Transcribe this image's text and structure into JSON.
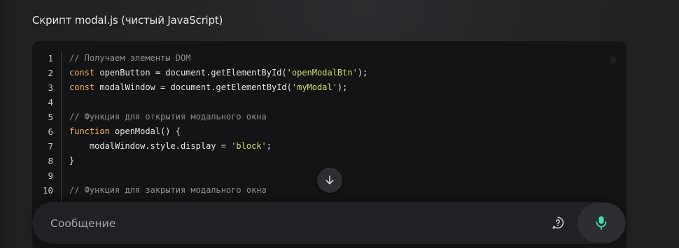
{
  "header": {
    "title": "Скрипт modal.js (чистый JavaScript)"
  },
  "code_block": {
    "line_numbers": [
      "1",
      "2",
      "3",
      "4",
      "5",
      "6",
      "7",
      "8",
      "9",
      "10"
    ],
    "lines": [
      [
        {
          "text": "// Получаем элементы DOM",
          "type": "comment"
        }
      ],
      [
        {
          "text": "const",
          "type": "keyword"
        },
        {
          "text": " openButton = document.getElementById(",
          "type": "plain"
        },
        {
          "text": "'openModalBtn'",
          "type": "string"
        },
        {
          "text": ");",
          "type": "plain"
        }
      ],
      [
        {
          "text": "const",
          "type": "keyword"
        },
        {
          "text": " modalWindow = document.getElementById(",
          "type": "plain"
        },
        {
          "text": "'myModal'",
          "type": "string"
        },
        {
          "text": ");",
          "type": "plain"
        }
      ],
      [],
      [
        {
          "text": "// Функция для открытия модального окна",
          "type": "comment"
        }
      ],
      [
        {
          "text": "function",
          "type": "keyword"
        },
        {
          "text": " openModal() {",
          "type": "plain"
        }
      ],
      [
        {
          "text": "    modalWindow.style.display = ",
          "type": "plain"
        },
        {
          "text": "'block'",
          "type": "string"
        },
        {
          "text": ";",
          "type": "plain"
        }
      ],
      [
        {
          "text": "}",
          "type": "plain"
        }
      ],
      [],
      [
        {
          "text": "// Функция для закрытия модального окна",
          "type": "comment"
        }
      ]
    ]
  },
  "composer": {
    "placeholder": "Сообщение"
  },
  "icons": {
    "scroll_down": "arrow-down-icon",
    "help": "help-circle-icon",
    "mic": "microphone-icon"
  },
  "colors": {
    "keyword": "#ffb15e",
    "string": "#c6e36b",
    "comment": "#8a8f94",
    "mic_accent": "#3ee0a8"
  }
}
